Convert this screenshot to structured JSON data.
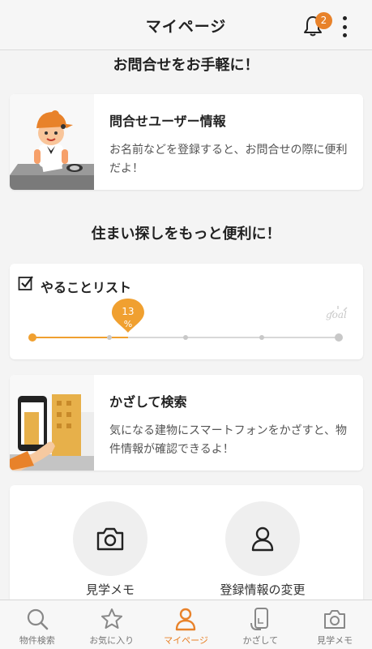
{
  "header": {
    "title": "マイページ",
    "notification_count": "2"
  },
  "sections": {
    "contact_heading": "お問合せをお手軽に！",
    "search_heading": "住まい探しをもっと便利に！"
  },
  "contact_card": {
    "title": "問合せユーザー情報",
    "description": "お名前などを登録すると、お問合せの際に便利だよ！"
  },
  "todo": {
    "title": "やることリスト",
    "progress_value": "13",
    "progress_unit": "%",
    "progress_fraction": 0.13,
    "goal_label": "goal"
  },
  "kazashi_card": {
    "title": "かざして検索",
    "description": "気になる建物にスマートフォンをかざすと、物件情報が確認できるよ！"
  },
  "shortcuts": [
    {
      "label": "見学メモ",
      "icon": "camera-icon"
    },
    {
      "label": "登録情報の変更",
      "icon": "person-icon"
    }
  ],
  "tabs": [
    {
      "label": "物件検索",
      "icon": "search-icon",
      "active": false
    },
    {
      "label": "お気に入り",
      "icon": "star-icon",
      "active": false
    },
    {
      "label": "マイページ",
      "icon": "person-icon",
      "active": true
    },
    {
      "label": "かざして",
      "icon": "phone-scan-icon",
      "active": false
    },
    {
      "label": "見学メモ",
      "icon": "camera-icon",
      "active": false
    }
  ],
  "colors": {
    "accent": "#e8822a",
    "progress_marker": "#f0a030",
    "text": "#222222"
  }
}
